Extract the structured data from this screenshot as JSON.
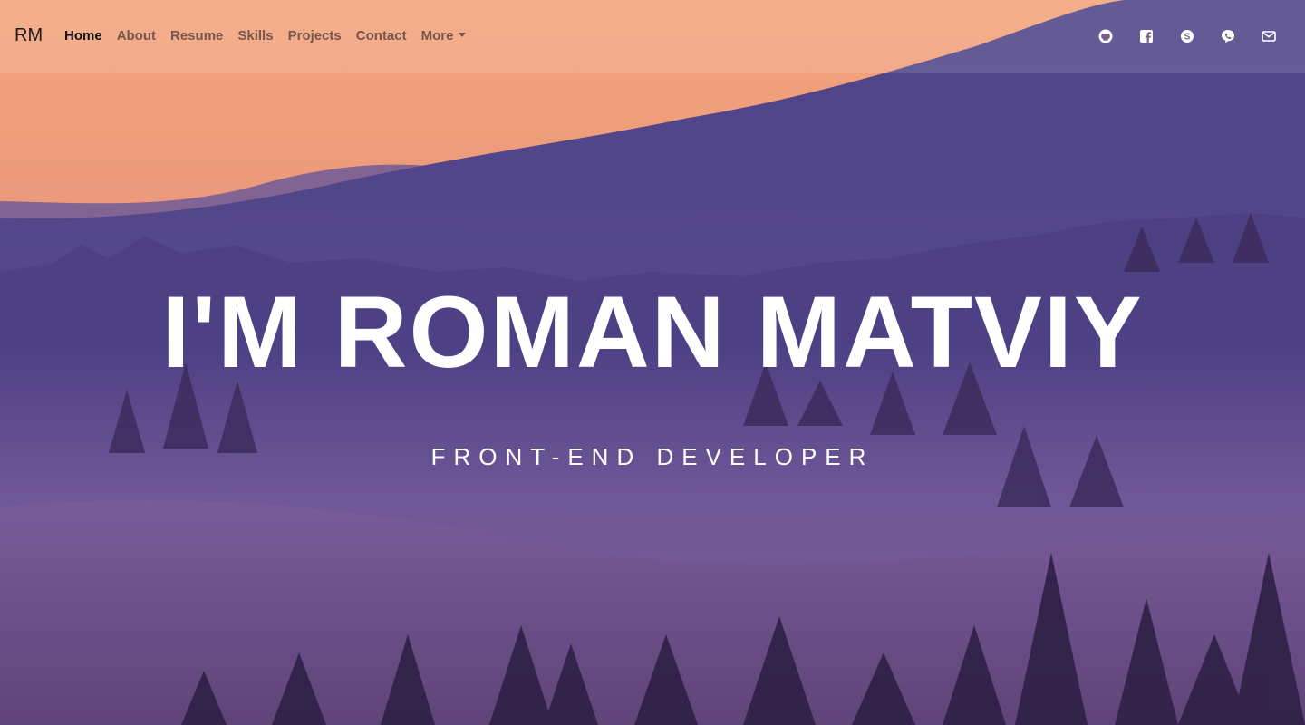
{
  "brand": "RM",
  "nav": {
    "items": [
      {
        "label": "Home",
        "active": true
      },
      {
        "label": "About"
      },
      {
        "label": "Resume"
      },
      {
        "label": "Skills"
      },
      {
        "label": "Projects"
      },
      {
        "label": "Contact"
      },
      {
        "label": "More",
        "dropdown": true
      }
    ]
  },
  "social": [
    {
      "icon": "github-icon"
    },
    {
      "icon": "facebook-icon"
    },
    {
      "icon": "skype-icon"
    },
    {
      "icon": "viber-icon"
    },
    {
      "icon": "email-icon"
    }
  ],
  "hero": {
    "title": "I'M ROMAN MATVIY",
    "subtitle": "FRONT-END DEVELOPER"
  },
  "colors": {
    "sky_top": "#f0a27a",
    "mountain": "#56488e",
    "fog": "#7a5c9e",
    "trees": "#3a2a55"
  }
}
